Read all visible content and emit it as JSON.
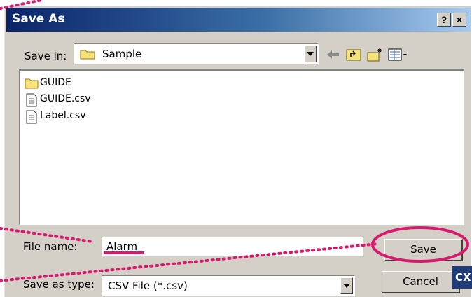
{
  "window": {
    "title": "Save As",
    "help_label": "?",
    "close_label": "×"
  },
  "save_in": {
    "label": "Save in:",
    "value": "Sample"
  },
  "files": [
    {
      "name": "GUIDE",
      "icon": "folder-icon"
    },
    {
      "name": "GUIDE.csv",
      "icon": "csv-file-icon"
    },
    {
      "name": "Label.csv",
      "icon": "csv-file-icon"
    }
  ],
  "file_name": {
    "label": "File name:",
    "value": "Alarm"
  },
  "save_as_type": {
    "label": "Save as type:",
    "value": "CSV File (*.csv)"
  },
  "buttons": {
    "save_label": "Save",
    "cancel_label": "Cancel"
  },
  "badge_text": "CX",
  "colors": {
    "annotation": "#d61a6e",
    "title_bar": "#0a246a",
    "dialog_face": "#d4d0c8"
  },
  "toolbar_icons": [
    "back-arrow-icon",
    "up-folder-icon",
    "new-folder-icon",
    "view-menu-icon"
  ]
}
